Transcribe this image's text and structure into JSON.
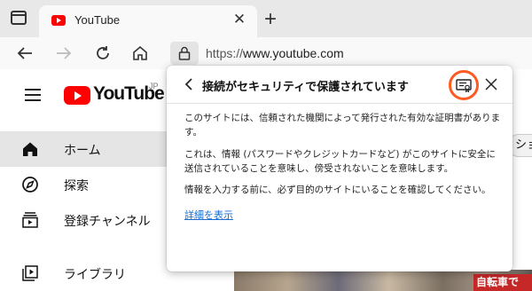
{
  "browser": {
    "tab": {
      "title": "YouTube"
    },
    "address": {
      "protocol": "https://",
      "host": "www.youtube.com"
    }
  },
  "youtube": {
    "logo_text": "YouTube",
    "region": "JP",
    "sidebar": [
      {
        "label": "ホーム",
        "icon": "home-icon",
        "active": true
      },
      {
        "label": "探索",
        "icon": "compass-icon",
        "active": false
      },
      {
        "label": "登録チャンネル",
        "icon": "subscriptions-icon",
        "active": false
      },
      {
        "label": "ライブラリ",
        "icon": "library-icon",
        "active": false
      }
    ],
    "chip_partial": "ショ",
    "thumb_badge": "自転車で"
  },
  "security_popup": {
    "title": "接続がセキュリティで保護されています",
    "para1": "このサイトには、信頼された機関によって発行された有効な証明書があります。",
    "para2": "これは、情報 (パスワードやクレジットカードなど) がこのサイトに安全に送信されていることを意味し、傍受されないことを意味します。",
    "para3": "情報を入力する前に、必ず目的のサイトにいることを確認してください。",
    "link": "詳細を表示"
  },
  "colors": {
    "accent_highlight": "#ff5a1f",
    "link": "#1a6ccf",
    "youtube_red": "#ff0000"
  }
}
